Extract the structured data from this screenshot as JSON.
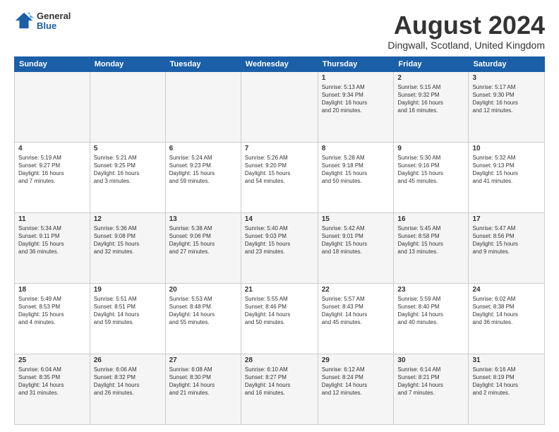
{
  "logo": {
    "general": "General",
    "blue": "Blue"
  },
  "header": {
    "title": "August 2024",
    "subtitle": "Dingwall, Scotland, United Kingdom"
  },
  "weekdays": [
    "Sunday",
    "Monday",
    "Tuesday",
    "Wednesday",
    "Thursday",
    "Friday",
    "Saturday"
  ],
  "weeks": [
    [
      {
        "day": "",
        "text": ""
      },
      {
        "day": "",
        "text": ""
      },
      {
        "day": "",
        "text": ""
      },
      {
        "day": "",
        "text": ""
      },
      {
        "day": "1",
        "text": "Sunrise: 5:13 AM\nSunset: 9:34 PM\nDaylight: 16 hours\nand 20 minutes."
      },
      {
        "day": "2",
        "text": "Sunrise: 5:15 AM\nSunset: 9:32 PM\nDaylight: 16 hours\nand 16 minutes."
      },
      {
        "day": "3",
        "text": "Sunrise: 5:17 AM\nSunset: 9:30 PM\nDaylight: 16 hours\nand 12 minutes."
      }
    ],
    [
      {
        "day": "4",
        "text": "Sunrise: 5:19 AM\nSunset: 9:27 PM\nDaylight: 16 hours\nand 7 minutes."
      },
      {
        "day": "5",
        "text": "Sunrise: 5:21 AM\nSunset: 9:25 PM\nDaylight: 16 hours\nand 3 minutes."
      },
      {
        "day": "6",
        "text": "Sunrise: 5:24 AM\nSunset: 9:23 PM\nDaylight: 15 hours\nand 59 minutes."
      },
      {
        "day": "7",
        "text": "Sunrise: 5:26 AM\nSunset: 9:20 PM\nDaylight: 15 hours\nand 54 minutes."
      },
      {
        "day": "8",
        "text": "Sunrise: 5:28 AM\nSunset: 9:18 PM\nDaylight: 15 hours\nand 50 minutes."
      },
      {
        "day": "9",
        "text": "Sunrise: 5:30 AM\nSunset: 9:16 PM\nDaylight: 15 hours\nand 45 minutes."
      },
      {
        "day": "10",
        "text": "Sunrise: 5:32 AM\nSunset: 9:13 PM\nDaylight: 15 hours\nand 41 minutes."
      }
    ],
    [
      {
        "day": "11",
        "text": "Sunrise: 5:34 AM\nSunset: 9:11 PM\nDaylight: 15 hours\nand 36 minutes."
      },
      {
        "day": "12",
        "text": "Sunrise: 5:36 AM\nSunset: 9:08 PM\nDaylight: 15 hours\nand 32 minutes."
      },
      {
        "day": "13",
        "text": "Sunrise: 5:38 AM\nSunset: 9:06 PM\nDaylight: 15 hours\nand 27 minutes."
      },
      {
        "day": "14",
        "text": "Sunrise: 5:40 AM\nSunset: 9:03 PM\nDaylight: 15 hours\nand 23 minutes."
      },
      {
        "day": "15",
        "text": "Sunrise: 5:42 AM\nSunset: 9:01 PM\nDaylight: 15 hours\nand 18 minutes."
      },
      {
        "day": "16",
        "text": "Sunrise: 5:45 AM\nSunset: 8:58 PM\nDaylight: 15 hours\nand 13 minutes."
      },
      {
        "day": "17",
        "text": "Sunrise: 5:47 AM\nSunset: 8:56 PM\nDaylight: 15 hours\nand 9 minutes."
      }
    ],
    [
      {
        "day": "18",
        "text": "Sunrise: 5:49 AM\nSunset: 8:53 PM\nDaylight: 15 hours\nand 4 minutes."
      },
      {
        "day": "19",
        "text": "Sunrise: 5:51 AM\nSunset: 8:51 PM\nDaylight: 14 hours\nand 59 minutes."
      },
      {
        "day": "20",
        "text": "Sunrise: 5:53 AM\nSunset: 8:48 PM\nDaylight: 14 hours\nand 55 minutes."
      },
      {
        "day": "21",
        "text": "Sunrise: 5:55 AM\nSunset: 8:46 PM\nDaylight: 14 hours\nand 50 minutes."
      },
      {
        "day": "22",
        "text": "Sunrise: 5:57 AM\nSunset: 8:43 PM\nDaylight: 14 hours\nand 45 minutes."
      },
      {
        "day": "23",
        "text": "Sunrise: 5:59 AM\nSunset: 8:40 PM\nDaylight: 14 hours\nand 40 minutes."
      },
      {
        "day": "24",
        "text": "Sunrise: 6:02 AM\nSunset: 8:38 PM\nDaylight: 14 hours\nand 36 minutes."
      }
    ],
    [
      {
        "day": "25",
        "text": "Sunrise: 6:04 AM\nSunset: 8:35 PM\nDaylight: 14 hours\nand 31 minutes."
      },
      {
        "day": "26",
        "text": "Sunrise: 6:06 AM\nSunset: 8:32 PM\nDaylight: 14 hours\nand 26 minutes."
      },
      {
        "day": "27",
        "text": "Sunrise: 6:08 AM\nSunset: 8:30 PM\nDaylight: 14 hours\nand 21 minutes."
      },
      {
        "day": "28",
        "text": "Sunrise: 6:10 AM\nSunset: 8:27 PM\nDaylight: 14 hours\nand 16 minutes."
      },
      {
        "day": "29",
        "text": "Sunrise: 6:12 AM\nSunset: 8:24 PM\nDaylight: 14 hours\nand 12 minutes."
      },
      {
        "day": "30",
        "text": "Sunrise: 6:14 AM\nSunset: 8:21 PM\nDaylight: 14 hours\nand 7 minutes."
      },
      {
        "day": "31",
        "text": "Sunrise: 6:16 AM\nSunset: 8:19 PM\nDaylight: 14 hours\nand 2 minutes."
      }
    ]
  ]
}
